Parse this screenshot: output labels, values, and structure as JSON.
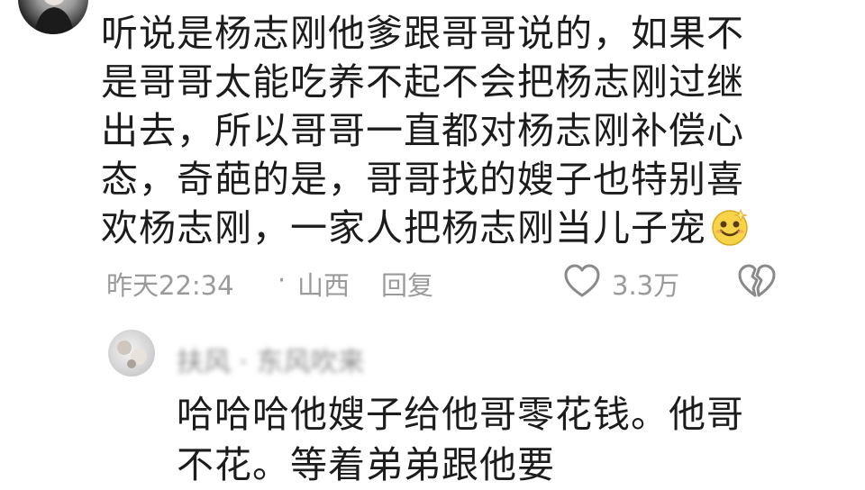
{
  "comment": {
    "text": "听说是杨志刚他爹跟哥哥说的，如果不是哥哥太能吃养不起不会把杨志刚过继出去，所以哥哥一直都对杨志刚补偿心态，奇葩的是，哥哥找的嫂子也特别喜欢杨志刚，一家人把杨志刚当儿子宠",
    "emoji": "smile-emoji-icon",
    "time": "昨天22:34",
    "separator": "·",
    "location": "山西",
    "reply_label": "回复",
    "like_count": "3.3万"
  },
  "reply": {
    "author": "扶风 · 东风吹来",
    "text": "哈哈哈他嫂子给他哥零花钱。他哥不花。等着弟弟跟他要"
  },
  "colors": {
    "text": "#1c1c1c",
    "meta": "#9a9a9a",
    "background": "#ffffff"
  }
}
